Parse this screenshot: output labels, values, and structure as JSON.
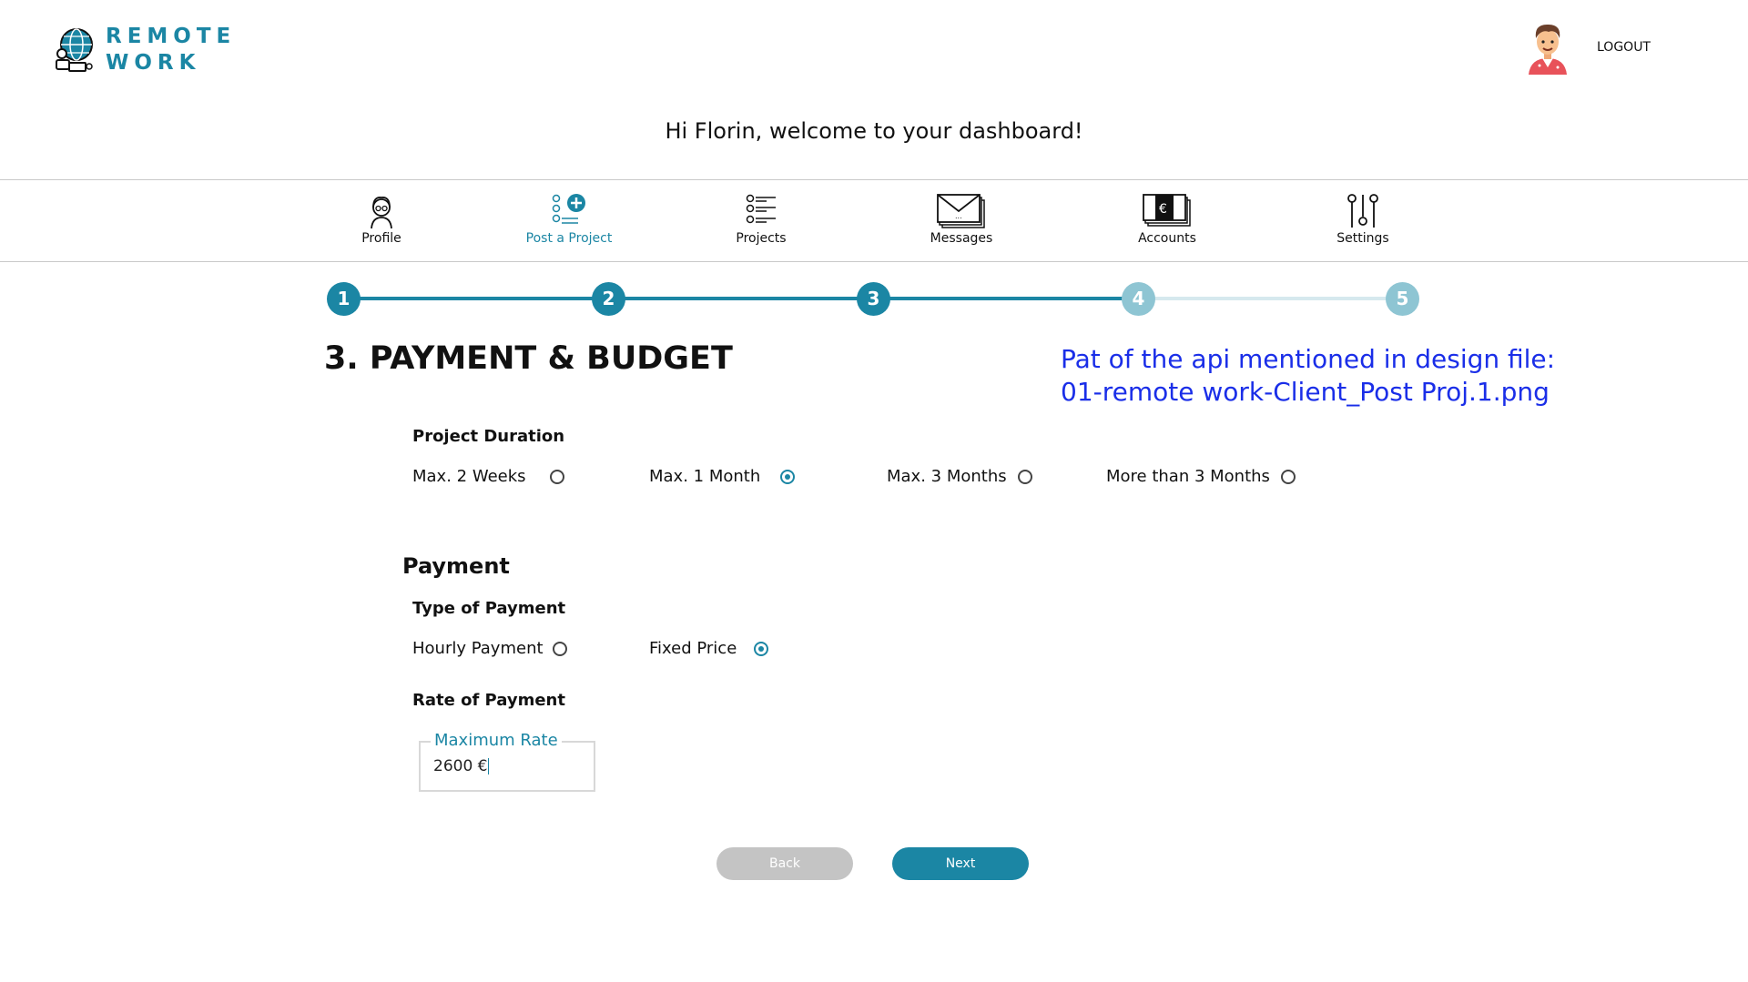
{
  "brand": {
    "line1": "REMOTE",
    "line2": "WORK",
    "icon": "globe-laptop-icon",
    "accent": "#1b86a4"
  },
  "header": {
    "logout_label": "LOGOUT",
    "avatar_icon": "user-avatar-icon"
  },
  "welcome": "Hi Florin, welcome to your dashboard!",
  "nav": [
    {
      "label": "Profile",
      "icon": "profile-icon",
      "active": false
    },
    {
      "label": "Post a Project",
      "icon": "post-project-icon",
      "active": true
    },
    {
      "label": "Projects",
      "icon": "checklist-icon",
      "active": false
    },
    {
      "label": "Messages",
      "icon": "envelope-icon",
      "active": false
    },
    {
      "label": "Accounts",
      "icon": "euro-banknote-icon",
      "active": false
    },
    {
      "label": "Settings",
      "icon": "sliders-icon",
      "active": false
    }
  ],
  "stepper": {
    "steps": [
      "1",
      "2",
      "3",
      "4",
      "5"
    ],
    "current": 3,
    "done_color": "#1b86a4",
    "todo_color": "#8ec5d3"
  },
  "section_title": "3. PAYMENT & BUDGET",
  "note": {
    "line1": "Pat of the api mentioned in design file:",
    "line2": "01-remote work-Client_Post Proj.1.png",
    "color": "#1a2ee8"
  },
  "duration": {
    "label": "Project Duration",
    "options": [
      {
        "label": "Max. 2 Weeks",
        "selected": false
      },
      {
        "label": "Max. 1 Month",
        "selected": true
      },
      {
        "label": "Max. 3 Months",
        "selected": false
      },
      {
        "label": "More than 3 Months",
        "selected": false
      }
    ]
  },
  "payment": {
    "heading": "Payment",
    "type_label": "Type of Payment",
    "types": [
      {
        "label": "Hourly Payment",
        "selected": false
      },
      {
        "label": "Fixed Price",
        "selected": true
      }
    ],
    "rate_label": "Rate of Payment",
    "rate_field_label": "Maximum Rate",
    "rate_value": "2600 €"
  },
  "buttons": {
    "back": "Back",
    "next": "Next"
  }
}
